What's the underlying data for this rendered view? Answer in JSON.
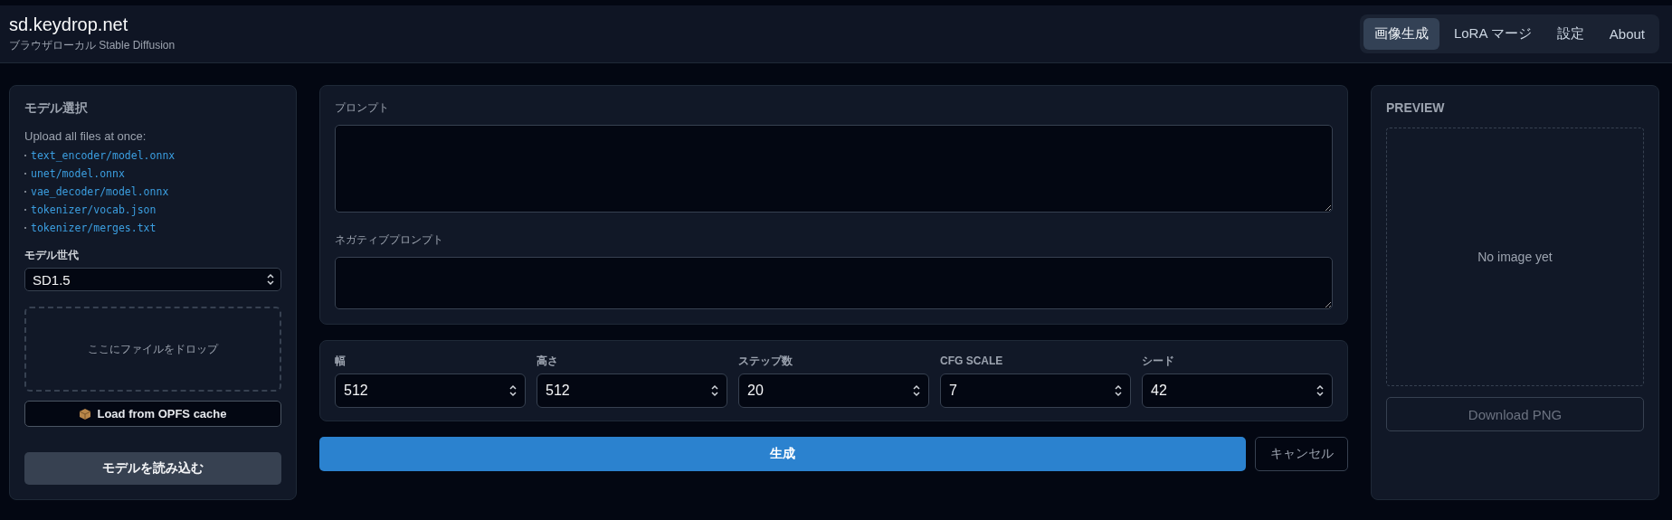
{
  "header": {
    "title": "sd.keydrop.net",
    "subtitle": "ブラウザローカル Stable Diffusion"
  },
  "nav": [
    {
      "label": "画像生成",
      "selected": true
    },
    {
      "label": "LoRA マージ",
      "selected": false
    },
    {
      "label": "設定",
      "selected": false
    },
    {
      "label": "About",
      "selected": false
    }
  ],
  "model_panel": {
    "title": "モデル選択",
    "upload_hint": "Upload all files at once:",
    "files": [
      "text_encoder/model.onnx",
      "unet/model.onnx",
      "vae_decoder/model.onnx",
      "tokenizer/vocab.json",
      "tokenizer/merges.txt"
    ],
    "generation_label": "モデル世代",
    "generation_value": "SD1.5",
    "dropzone": "ここにファイルをドロップ",
    "cache_button": "Load from OPFS cache",
    "load_button": "モデルを読み込む"
  },
  "prompts": [
    {
      "label": "プロンプト"
    },
    {
      "label": "ネガティブプロンプト"
    }
  ],
  "params": [
    {
      "label": "幅",
      "value": "512"
    },
    {
      "label": "高さ",
      "value": "512"
    },
    {
      "label": "ステップ数",
      "value": "20"
    },
    {
      "label": "CFG SCALE",
      "value": "7"
    },
    {
      "label": "シード",
      "value": "42"
    }
  ],
  "actions": {
    "generate": {
      "label": "生成",
      "disabled": false
    },
    "cancel": {
      "label": "キャンセル",
      "disabled": true
    }
  },
  "preview": {
    "title": "PREVIEW",
    "empty": "No image yet",
    "download": {
      "label": "Download PNG",
      "disabled": true
    }
  }
}
